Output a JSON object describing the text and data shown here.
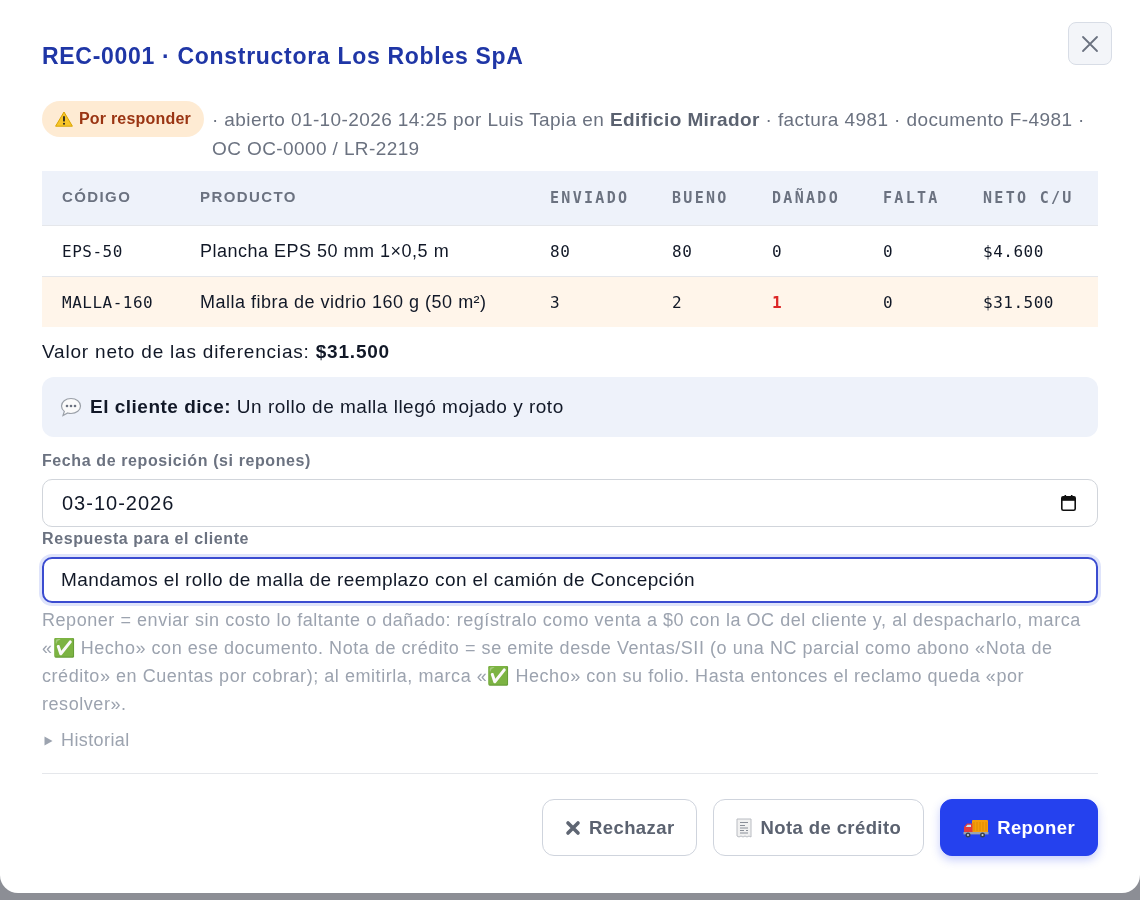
{
  "dialog": {
    "title": "REC-0001 · Constructora Los Robles SpA"
  },
  "status_badge": {
    "label": "Por responder",
    "kind": "warning"
  },
  "meta": "· abierto 01-10-2026 14:25 por Luis Tapia en **Edificio Mirador** · factura 4981 · documento F-4981 · OC OC-0000 / LR-2219",
  "table": {
    "columns": [
      {
        "label": "CÓDIGO",
        "kind": "code"
      },
      {
        "label": "PRODUCTO",
        "kind": "text"
      },
      {
        "label": "ENVIADO",
        "kind": "number"
      },
      {
        "label": "BUENO",
        "kind": "number"
      },
      {
        "label": "DAÑADO",
        "kind": "number"
      },
      {
        "label": "FALTA",
        "kind": "number"
      },
      {
        "label": "NETO C/U",
        "kind": "number"
      }
    ],
    "rows": [
      {
        "flagged": false,
        "cells": [
          {
            "text": "EPS-50",
            "alert": false
          },
          {
            "text": "Plancha EPS 50 mm 1×0,5 m",
            "alert": false
          },
          {
            "text": "80",
            "alert": false
          },
          {
            "text": "80",
            "alert": false
          },
          {
            "text": "0",
            "alert": false
          },
          {
            "text": "0",
            "alert": false
          },
          {
            "text": "$4.600",
            "alert": false
          }
        ]
      },
      {
        "flagged": true,
        "cells": [
          {
            "text": "MALLA-160",
            "alert": false
          },
          {
            "text": "Malla fibra de vidrio 160 g (50 m²)",
            "alert": false
          },
          {
            "text": "3",
            "alert": false
          },
          {
            "text": "2",
            "alert": false
          },
          {
            "text": "1",
            "alert": true
          },
          {
            "text": "0",
            "alert": false
          },
          {
            "text": "$31.500",
            "alert": false
          }
        ]
      }
    ]
  },
  "summary": "Valor neto de las diferencias: **$31.500**",
  "client_note": "**El cliente dice:** Un rollo de malla llegó mojado y roto",
  "fields": [
    {
      "kind": "date",
      "label": "Fecha de reposición (si repones)",
      "value": "03-10-2026",
      "focused": false
    },
    {
      "kind": "text",
      "label": "Respuesta para el cliente",
      "value": "Mandamos el rollo de malla de reemplazo con el camión de Concepción",
      "focused": true
    }
  ],
  "hint": "Reponer = enviar sin costo lo faltante o dañado: regístralo como venta a $0 con la OC del cliente y, al despacharlo, marca «✅ Hecho» con ese documento. Nota de crédito = se emite desde Ventas/SII (o una NC parcial como abono «Nota de crédito» en Cuentas por cobrar); al emitirla, marca «✅ Hecho» con su folio. Hasta entonces el reclamo queda «por resolver».",
  "history": {
    "label": "Historial",
    "expanded": false
  },
  "actions": [
    {
      "label": "Rechazar",
      "kind": "reject",
      "primary": false
    },
    {
      "label": "Nota de crédito",
      "kind": "credit",
      "primary": false
    },
    {
      "label": "Reponer",
      "kind": "restock",
      "primary": true
    }
  ]
}
